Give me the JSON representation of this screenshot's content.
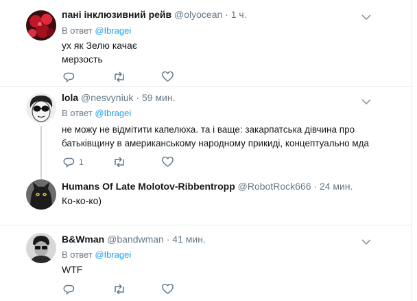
{
  "tweets": [
    {
      "name": "пані інклюзивний рейв",
      "handle": "@olyocean",
      "time": "1 ч.",
      "reply_prefix": "В ответ",
      "reply_to": "@Ibragei",
      "text": "ух як Зелю качає\nмерзость",
      "reply_count": "",
      "avatar_icon": "avatar-red-flowers"
    },
    {
      "name": "lola",
      "handle": "@nesvyniuk",
      "time": "59 мин.",
      "reply_prefix": "В ответ",
      "reply_to": "@Ibragei",
      "text": "не можу не відмітити капелюха. та і ваще: закарпатська дівчина про\nбатьківщину в американському народному прикиді, концептуально мда",
      "reply_count": "1",
      "avatar_icon": "avatar-sunglasses-face"
    },
    {
      "name": "Humans Of Late Molotov-Ribbentropp",
      "handle": "@RobotRock666",
      "time": "24 мин.",
      "text": "Ко-ко-ко)",
      "avatar_icon": "avatar-black-cat"
    },
    {
      "name": "B&Wman",
      "handle": "@bandwman",
      "time": "41 мин.",
      "reply_prefix": "В ответ",
      "reply_to": "@Ibragei",
      "text": "WTF",
      "reply_count": "",
      "avatar_icon": "avatar-bw-person"
    }
  ],
  "separator_dot": "·",
  "colors": {
    "accent": "#1da1f2",
    "secondary": "#657786",
    "border": "#e6ecf0"
  }
}
